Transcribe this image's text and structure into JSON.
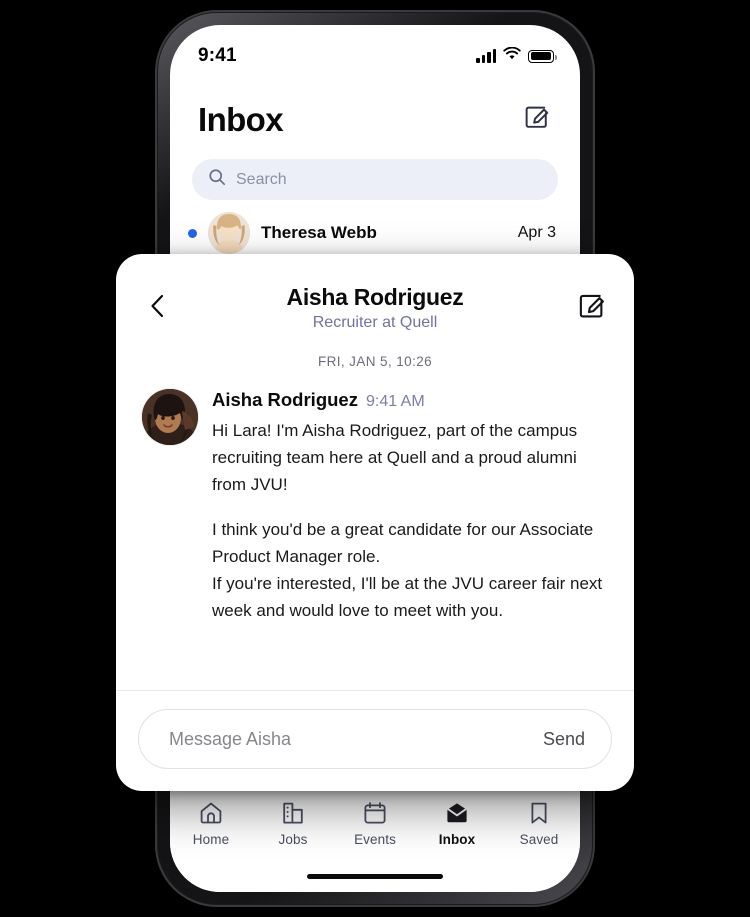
{
  "status_bar": {
    "time": "9:41",
    "icons": [
      "signal-icon",
      "wifi-icon",
      "battery-icon"
    ]
  },
  "inbox_screen": {
    "title": "Inbox",
    "compose_icon": "compose-icon",
    "search": {
      "placeholder": "Search",
      "icon": "search-icon"
    },
    "threads": [
      {
        "name": "Theresa Webb",
        "date": "Apr 3",
        "unread": true
      }
    ]
  },
  "tabbar": {
    "items": [
      {
        "label": "Home",
        "icon": "home-icon",
        "active": false
      },
      {
        "label": "Jobs",
        "icon": "building-icon",
        "active": false
      },
      {
        "label": "Events",
        "icon": "calendar-icon",
        "active": false
      },
      {
        "label": "Inbox",
        "icon": "envelope-icon",
        "active": true
      },
      {
        "label": "Saved",
        "icon": "bookmark-icon",
        "active": false
      }
    ]
  },
  "message_card": {
    "back_icon": "chevron-left-icon",
    "compose_icon": "compose-icon",
    "contact_name": "Aisha Rodriguez",
    "contact_role": "Recruiter at Quell",
    "datestamp": "FRI, JAN 5, 10:26",
    "message": {
      "sender": "Aisha Rodriguez",
      "time": "9:41 AM",
      "avatar": "aisha-avatar",
      "paragraphs": [
        "Hi Lara! I'm Aisha Rodriguez, part of the campus recruiting team here at Quell and a proud alumni from JVU!",
        "I think you'd be a great candidate for our Associate Product Manager role.\nIf you're interested, I'll be at the JVU career fair next week and would love to meet with you."
      ]
    },
    "composer": {
      "placeholder": "Message Aisha",
      "send_label": "Send"
    }
  },
  "colors": {
    "accent_unread": "#2563eb",
    "role_text": "#6f73a0",
    "search_bg": "#eceff8",
    "tab_inactive": "#4b4f63",
    "background": "#000000"
  }
}
